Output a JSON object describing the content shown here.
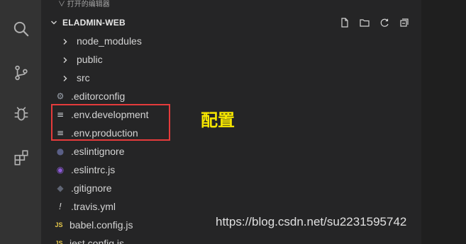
{
  "explorer": {
    "open_editors_label": "∨ 打开的编辑器",
    "project_label": "ELADMIN-WEB",
    "tree": [
      {
        "label": "node_modules",
        "kind": "folder",
        "icon": "chevron-right-icon"
      },
      {
        "label": "public",
        "kind": "folder",
        "icon": "chevron-right-icon"
      },
      {
        "label": "src",
        "kind": "folder",
        "icon": "chevron-right-icon"
      },
      {
        "label": ".editorconfig",
        "kind": "file",
        "icon": "gear-icon"
      },
      {
        "label": ".env.development",
        "kind": "file",
        "icon": "text-lines-icon"
      },
      {
        "label": ".env.production",
        "kind": "file",
        "icon": "text-lines-icon"
      },
      {
        "label": ".eslintignore",
        "kind": "file",
        "icon": "circle-icon"
      },
      {
        "label": ".eslintrc.js",
        "kind": "file",
        "icon": "circle-icon"
      },
      {
        "label": ".gitignore",
        "kind": "file",
        "icon": "diamond-icon"
      },
      {
        "label": ".travis.yml",
        "kind": "file",
        "icon": "exclamation-icon"
      },
      {
        "label": "babel.config.js",
        "kind": "file",
        "icon": "js-icon"
      },
      {
        "label": "jest.config.js",
        "kind": "file",
        "icon": "js-icon"
      }
    ]
  },
  "annotation": {
    "text": "配置"
  },
  "watermark": {
    "text": "https://blog.csdn.net/su2231595742"
  },
  "icons": {
    "activity_bar": [
      "search-icon",
      "source-control-icon",
      "debug-icon",
      "extensions-icon"
    ],
    "header_actions": [
      "new-file-icon",
      "new-folder-icon",
      "refresh-icon",
      "collapse-all-icon"
    ]
  },
  "colors": {
    "highlight_box": "#e53b3b",
    "annotation_text": "#f6e600",
    "js_icon": "#e6c84b",
    "eslint_icon": "#8c5ad7"
  }
}
